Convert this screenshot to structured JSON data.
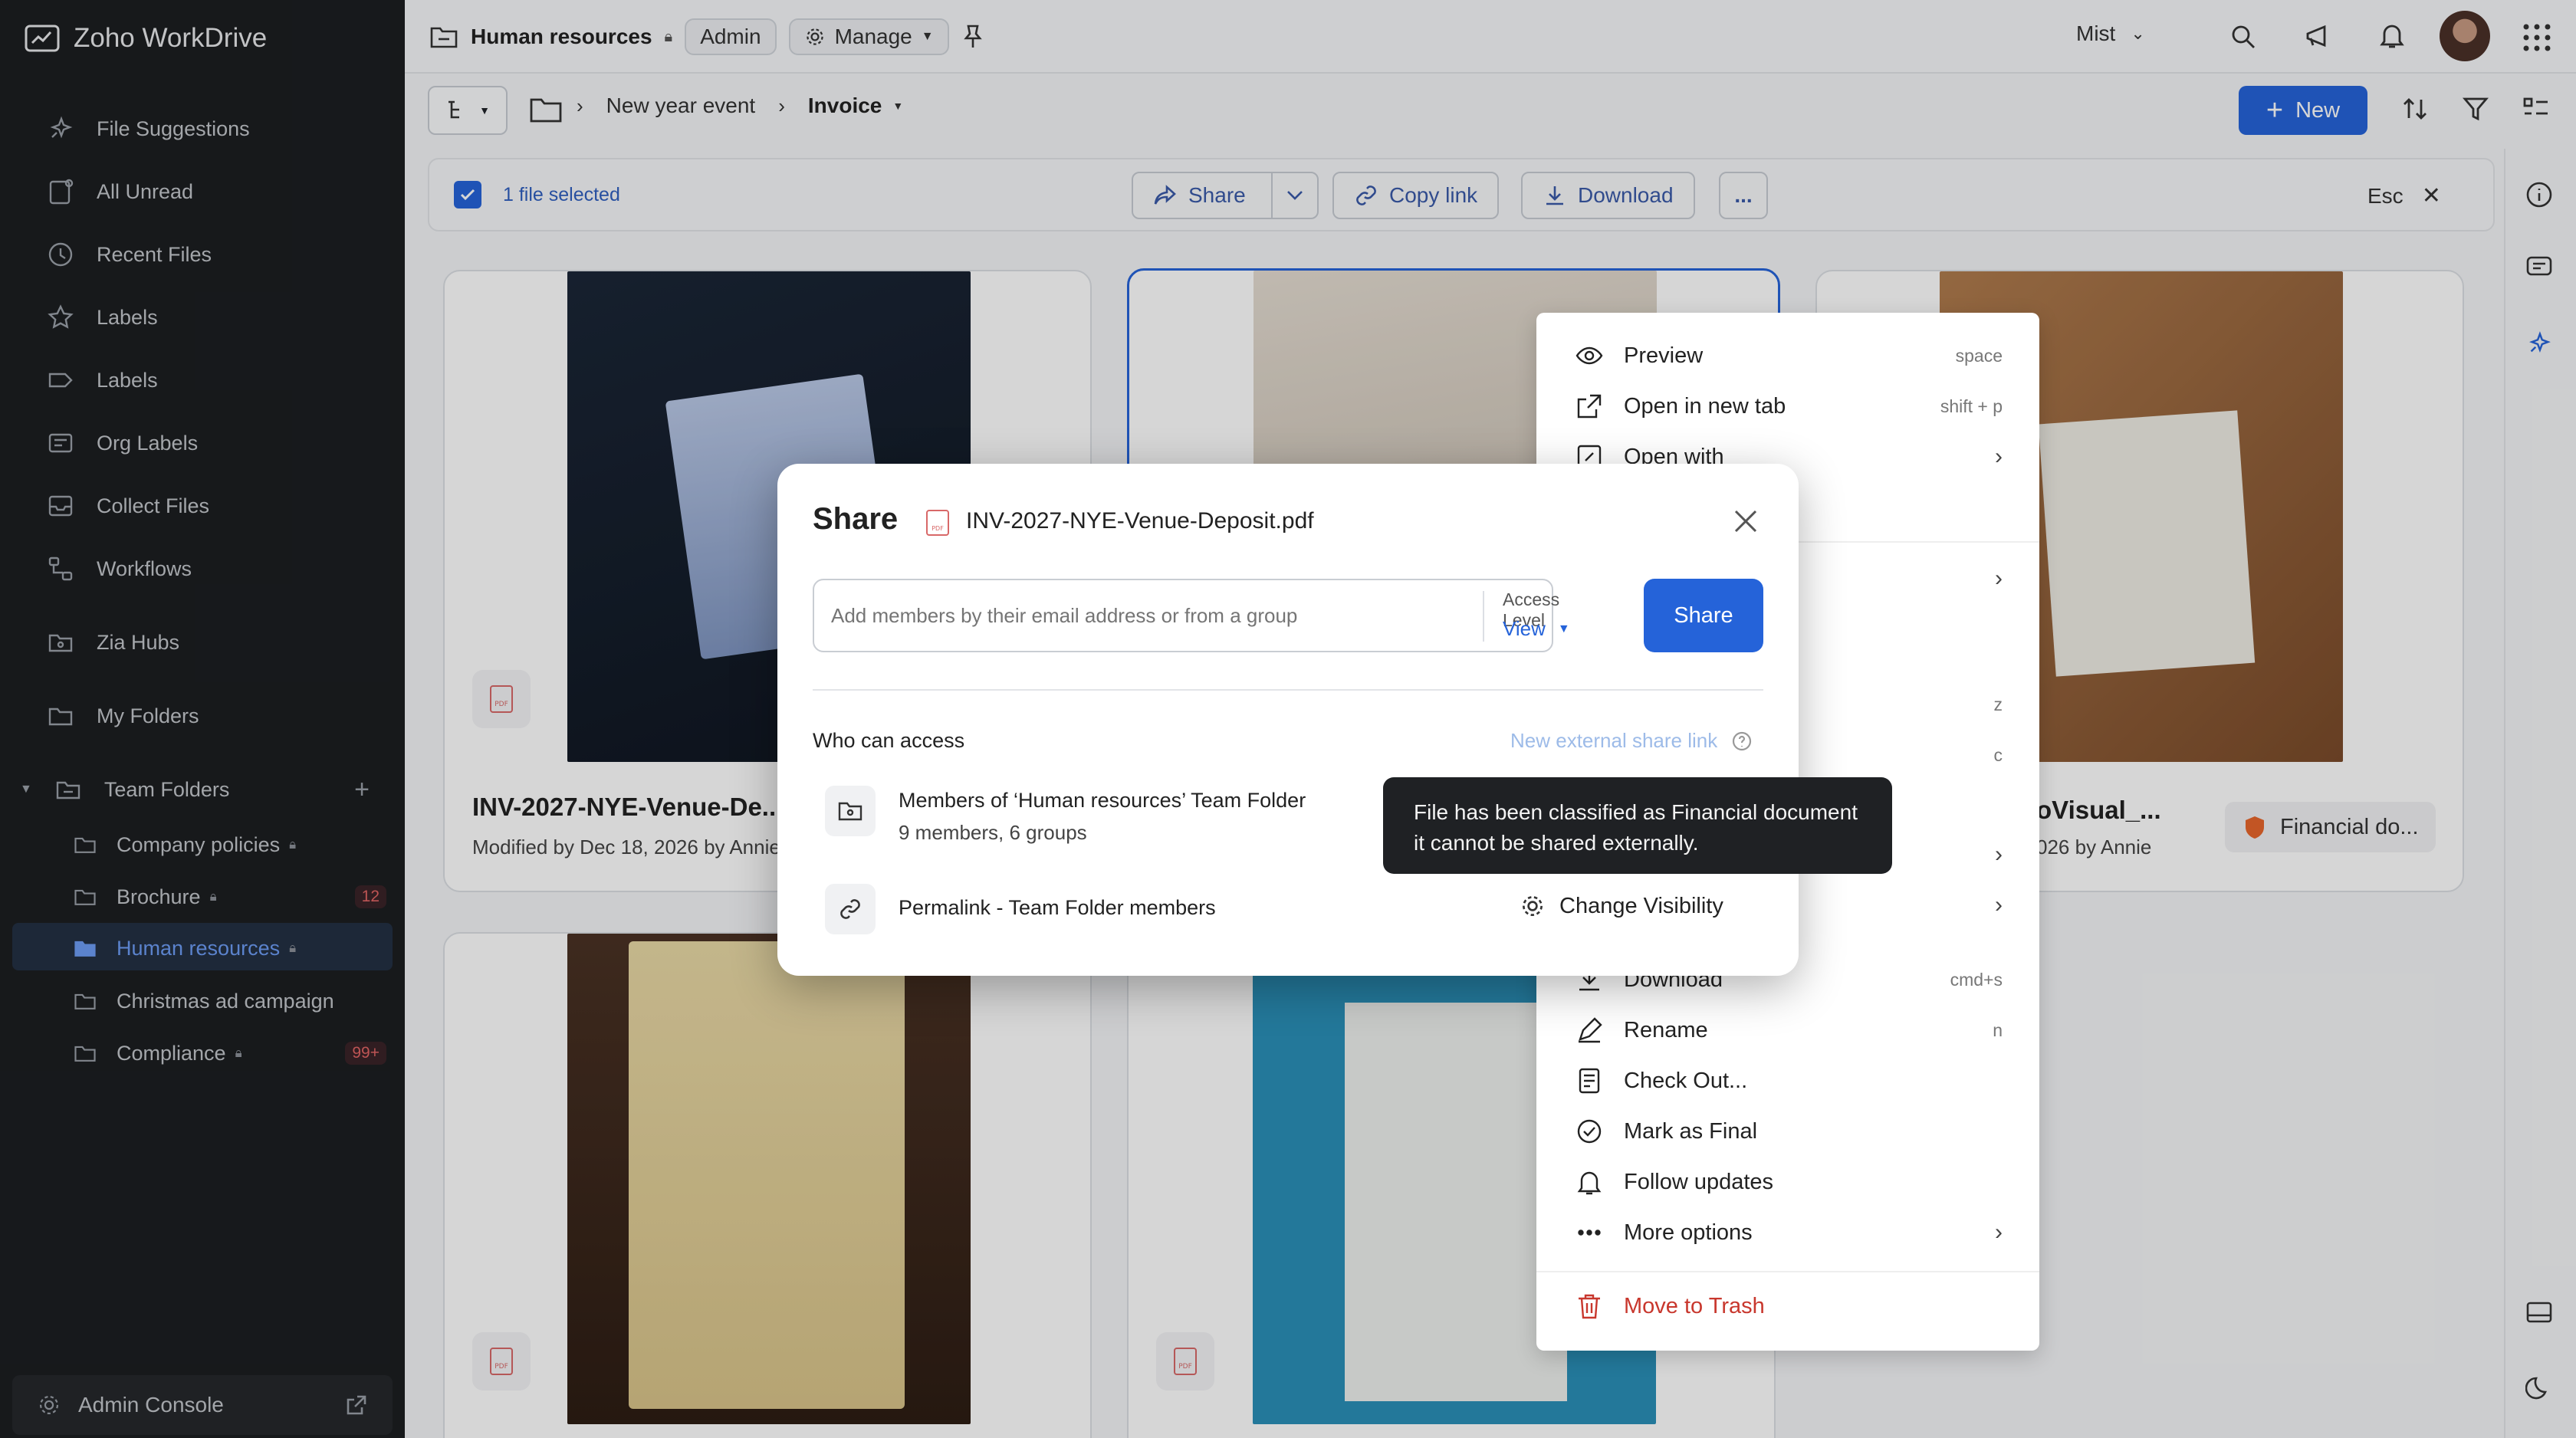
{
  "app": {
    "title": "Zoho WorkDrive"
  },
  "sidebar": {
    "items": [
      {
        "label": "File Suggestions"
      },
      {
        "label": "All Unread"
      },
      {
        "label": "Recent Files"
      },
      {
        "label": "Labels"
      },
      {
        "label": "Labels"
      },
      {
        "label": "Org Labels"
      },
      {
        "label": "Collect Files"
      },
      {
        "label": "Workflows"
      },
      {
        "label": "Zia Hubs"
      },
      {
        "label": "My Folders"
      },
      {
        "label": "Team Folders"
      }
    ],
    "team_folders": [
      {
        "label": "Company policies",
        "count": ""
      },
      {
        "label": "Brochure",
        "count": "12"
      },
      {
        "label": "Human resources",
        "count": ""
      },
      {
        "label": "Christmas ad campaign",
        "count": ""
      },
      {
        "label": "Compliance",
        "count": "99+"
      }
    ],
    "admin_console": "Admin Console"
  },
  "header": {
    "folder_name": "Human resources",
    "role_badge": "Admin",
    "manage_label": "Manage",
    "user_name": "Mist"
  },
  "breadcrumb": {
    "items": [
      "New year event",
      "Invoice"
    ]
  },
  "new_button": "New",
  "selection_bar": {
    "selected_text": "1 file selected",
    "share": "Share",
    "copy_link": "Copy link",
    "download": "Download",
    "more": "...",
    "esc": "Esc"
  },
  "files": [
    {
      "title": "INV-2027-NYE-Venue-De...",
      "sub": "Modified by Dec 18, 2026 by Annie"
    },
    {
      "title": "oVisual_...",
      "sub": "026 by Annie"
    }
  ],
  "financial_badge": "Financial do...",
  "context_menu": {
    "items": [
      {
        "label": "Preview",
        "shortcut": "space"
      },
      {
        "label": "Open in new tab",
        "shortcut": "shift + p"
      },
      {
        "label": "Open with",
        "shortcut": ""
      },
      {
        "label": "Download",
        "shortcut": "cmd+s"
      },
      {
        "label": "Rename",
        "shortcut": "n"
      },
      {
        "label": "Check Out...",
        "shortcut": ""
      },
      {
        "label": "Mark as Final",
        "shortcut": ""
      },
      {
        "label": "Follow updates",
        "shortcut": ""
      },
      {
        "label": "More options",
        "shortcut": ""
      },
      {
        "label": "Move to Trash",
        "shortcut": ""
      }
    ],
    "extra_shortcuts": [
      "z",
      "c"
    ]
  },
  "share_dialog": {
    "title": "Share",
    "file_name": "INV-2027-NYE-Venue-Deposit.pdf",
    "input_placeholder": "Add members by their email address or from a group",
    "access_level_label": "Access Level",
    "access_level_value": "View",
    "share_button": "Share",
    "who_can_access": "Who can access",
    "new_external_link": "New external share link",
    "members_title": "Members of ‘Human resources’ Team Folder",
    "members_sub": "9 members, 6 groups",
    "permalink": "Permalink - Team Folder members",
    "change_visibility": "Change Visibility"
  },
  "tooltip": {
    "text": "File has been classified as Financial document it cannot be shared externally."
  },
  "colors": {
    "accent": "#2563d9",
    "sidebar_bg": "#1c1e21",
    "danger": "#c8372d",
    "tooltip_bg": "#1f2124"
  }
}
